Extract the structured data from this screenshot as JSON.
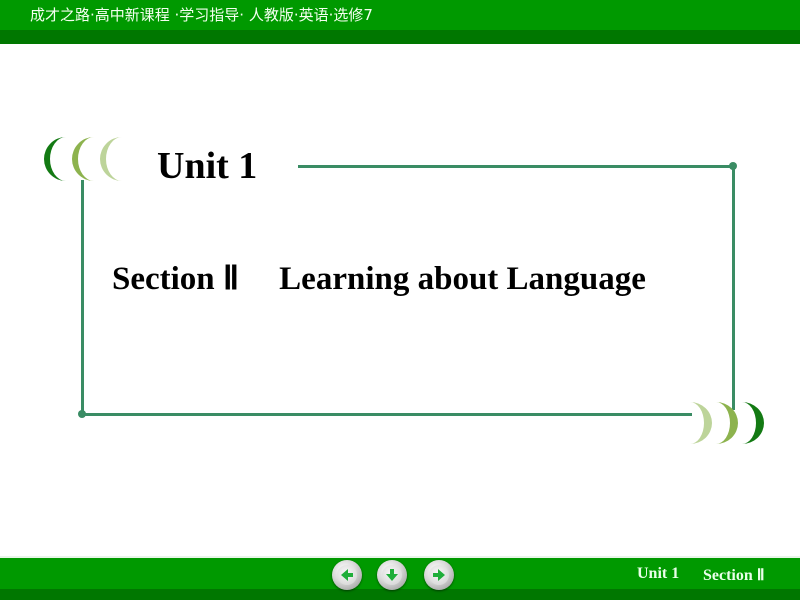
{
  "header": {
    "title": "成才之路·高中新课程 ·学习指导· 人教版·英语·选修7"
  },
  "slide": {
    "unit_title": "Unit 1",
    "section_label": "Section Ⅱ",
    "section_subtitle": "Learning about Language"
  },
  "footer": {
    "nav": [
      {
        "name": "previous",
        "icon": "arrow-left-icon"
      },
      {
        "name": "home",
        "icon": "arrow-down-icon"
      },
      {
        "name": "next",
        "icon": "arrow-right-icon"
      }
    ],
    "unit_label": "Unit 1",
    "section_label": "Section Ⅱ"
  },
  "colors": {
    "header_green": "#009900",
    "header_dark_green": "#007700",
    "frame_line": "#3a8c64",
    "crescent_dark": "#137a13",
    "crescent_mid": "#8db34e",
    "crescent_light": "#bdd49a",
    "nav_arrow": "#1fae3a"
  }
}
